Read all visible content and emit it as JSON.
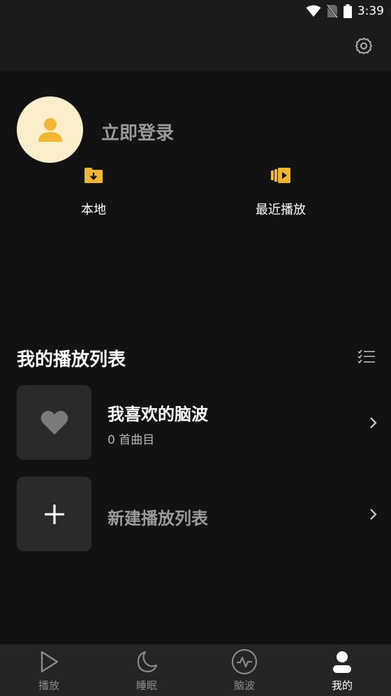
{
  "status": {
    "time": "3:39",
    "icons": [
      "wifi-icon",
      "no-sim-icon",
      "battery-icon"
    ]
  },
  "header": {
    "settings_icon": "gear-icon"
  },
  "profile": {
    "login_label": "立即登录",
    "avatar_icon": "user-icon"
  },
  "quick_actions": [
    {
      "label": "本地",
      "icon": "folder-download-icon"
    },
    {
      "label": "最近播放",
      "icon": "recent-play-icon"
    }
  ],
  "playlists": {
    "title": "我的播放列表",
    "items": [
      {
        "name": "我喜欢的脑波",
        "count": "0 首曲目"
      }
    ],
    "new_label": "新建播放列表"
  },
  "bottom_nav": {
    "items": [
      {
        "label": "播放",
        "icon": "play-icon",
        "active": false
      },
      {
        "label": "睡眠",
        "icon": "moon-icon",
        "active": false
      },
      {
        "label": "脑波",
        "icon": "brainwave-icon",
        "active": false
      },
      {
        "label": "我的",
        "icon": "person-icon",
        "active": true
      }
    ]
  },
  "colors": {
    "accent": "#f2b630",
    "background": "#121212",
    "card": "#2a2a2a",
    "avatar_bg": "#fbeecb"
  }
}
